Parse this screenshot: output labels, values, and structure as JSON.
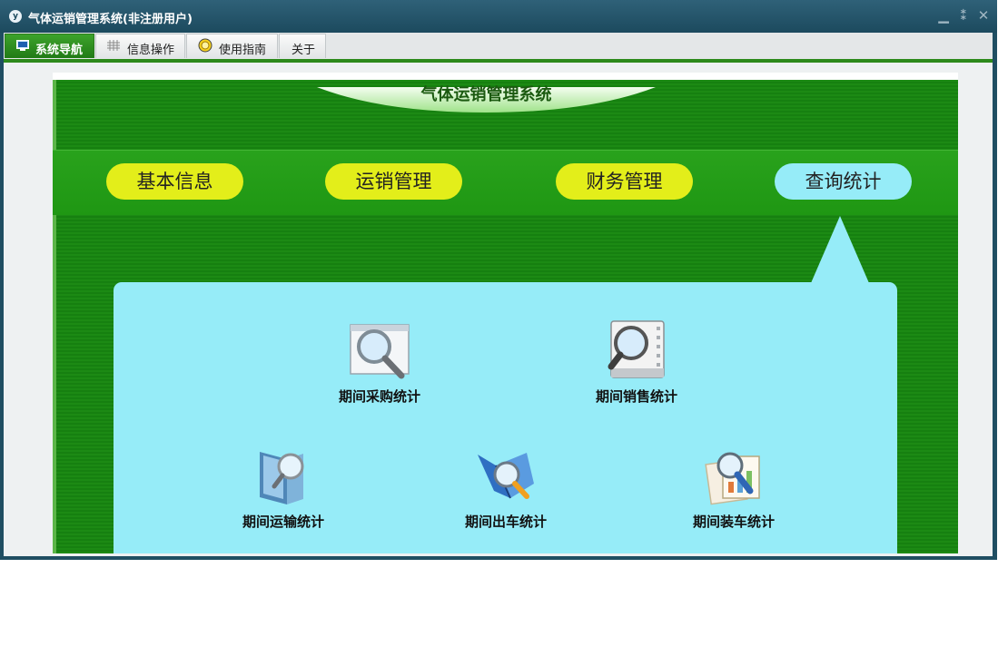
{
  "window": {
    "logo": "y",
    "title": "气体运销管理系统(非注册用户)",
    "controls": [
      {
        "name": "minimize-icon",
        "glyph": "▁"
      },
      {
        "name": "restore-icon",
        "glyph": "⁑"
      },
      {
        "name": "close-icon",
        "glyph": "✕"
      }
    ]
  },
  "tabs": [
    {
      "label": "系统导航",
      "icon": "monitor-icon",
      "active": true
    },
    {
      "label": "信息操作",
      "icon": "grid-icon",
      "active": false
    },
    {
      "label": "使用指南",
      "icon": "compass-icon",
      "active": false
    },
    {
      "label": "关于",
      "icon": "",
      "active": false
    }
  ],
  "header": {
    "title": "气体运销管理系统"
  },
  "nav": [
    {
      "label": "基本信息",
      "active": false
    },
    {
      "label": "运销管理",
      "active": false
    },
    {
      "label": "财务管理",
      "active": false
    },
    {
      "label": "查询统计",
      "active": true
    }
  ],
  "items": [
    {
      "label": "期间采购统计",
      "icon": "magnifier-window-icon"
    },
    {
      "label": "期间销售统计",
      "icon": "magnifier-film-icon"
    },
    {
      "label": "期间运输统计",
      "icon": "magnifier-book-icon"
    },
    {
      "label": "期间出车统计",
      "icon": "magnifier-map-icon"
    },
    {
      "label": "期间装车统计",
      "icon": "magnifier-chart-icon"
    }
  ],
  "colors": {
    "accent_green": "#1c8a14",
    "nav_button": "#e3ee1a",
    "nav_active": "#96ecf8",
    "titlebar": "#1c4a5e"
  }
}
